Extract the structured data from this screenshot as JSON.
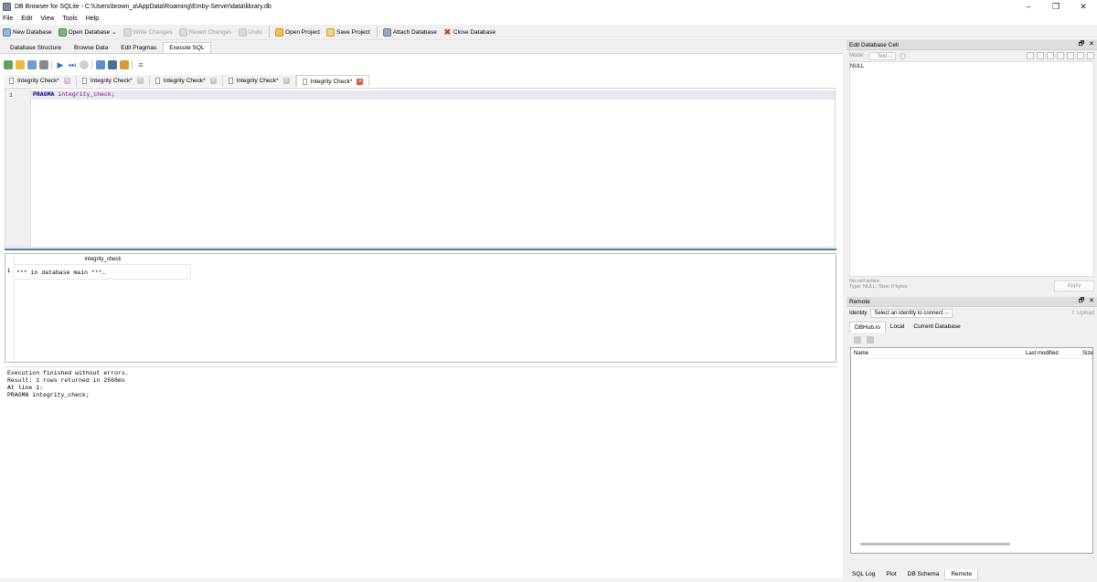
{
  "window": {
    "title": "DB Browser for SQLite - C:\\Users\\brown_a\\AppData\\Roaming\\Emby-Server\\data\\library.db",
    "minimize": "–",
    "maximize": "❐",
    "close": "✕"
  },
  "menu": [
    "File",
    "Edit",
    "View",
    "Tools",
    "Help"
  ],
  "toolbar": {
    "new_database": "New Database",
    "open_database": "Open Database",
    "write_changes": "Write Changes",
    "revert_changes": "Revert Changes",
    "undo": "Undo",
    "open_project": "Open Project",
    "save_project": "Save Project",
    "attach_database": "Attach Database",
    "close_database": "Close Database"
  },
  "main_tabs": [
    "Database Structure",
    "Browse Data",
    "Edit Pragmas",
    "Execute SQL"
  ],
  "editor_tabs": [
    "Integrity Check*",
    "Integrity Check*",
    "Integrity Check*",
    "Integrity Check*",
    "Integrity Check*"
  ],
  "editor": {
    "line_number": "1",
    "keyword": "PRAGMA",
    "rest": " integrity_check;"
  },
  "results": {
    "column": "integrity_check",
    "row_number": "1",
    "cell": "*** in database main ***…"
  },
  "log": [
    "Execution finished without errors.",
    "Result: 1 rows returned in 2568ms",
    "At line 1:",
    "PRAGMA integrity_check;"
  ],
  "edit_cell": {
    "title": "Edit Database Cell",
    "mode_label": "Mode:",
    "mode_value": "Text",
    "value": "NULL",
    "status_line1": "No cell active.",
    "status_line2": "Type: NULL; Size: 0 bytes",
    "apply": "Apply",
    "float": "🗗",
    "close": "✕"
  },
  "remote": {
    "title": "Remote",
    "identity_label": "Identity",
    "identity_value": "Select an identity to connect  ⌵",
    "upload": "Upload",
    "tabs": [
      "DBHub.io",
      "Local",
      "Current Database"
    ],
    "col_name": "Name",
    "col_modified": "Last modified",
    "col_size": "Size"
  },
  "bottom_tabs": [
    "SQL Log",
    "Plot",
    "DB Schema",
    "Remote"
  ]
}
